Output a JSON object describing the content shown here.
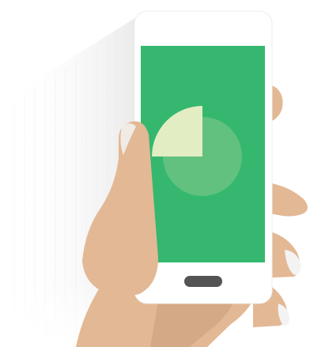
{
  "illustration": {
    "subject": "hand-holding-phone",
    "chart": {
      "type": "pie",
      "highlighted_fraction": 0.25
    },
    "colors": {
      "background": "#ffffff",
      "phone_body": "#ffffff",
      "screen": "#35b76f",
      "pie_circle": "#62c17f",
      "pie_slice": "#e2edc3",
      "home_button": "#545454",
      "skin": "#e3b894",
      "skin_shadow": "#c89c78",
      "fingernail": "#f3f3f3",
      "motion_trail": "#eeeeee"
    }
  }
}
